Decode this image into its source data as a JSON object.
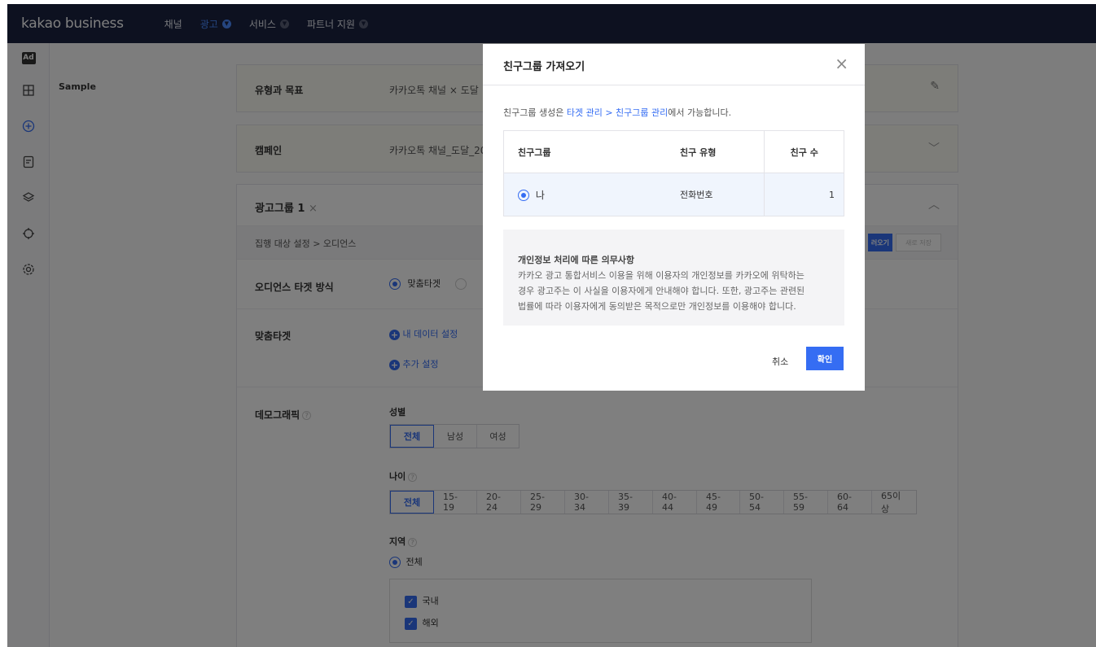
{
  "topbar": {
    "brand": "kakao business",
    "nav": [
      {
        "label": "채널",
        "dropdown": false,
        "active": false
      },
      {
        "label": "광고",
        "dropdown": true,
        "active": true
      },
      {
        "label": "서비스",
        "dropdown": true,
        "active": false
      },
      {
        "label": "파트너 지원",
        "dropdown": true,
        "active": false
      }
    ]
  },
  "rail": {
    "ad_badge": "Ad",
    "items": [
      "dashboard-icon",
      "add-circle-icon",
      "document-icon",
      "layers-icon",
      "target-icon",
      "settings-icon"
    ]
  },
  "main": {
    "sample_label": "Sample",
    "type_goal": {
      "label": "유형과 목표",
      "value": "카카오톡 채널 × 도달"
    },
    "campaign": {
      "label": "캠페인",
      "value": "카카오톡 채널_도달_20"
    },
    "adgroup": {
      "title": "광고그룹 1",
      "breadcrumb": "집행 대상 설정 > 오디언스",
      "load_button": "러오기",
      "save_button": "새로 저장",
      "audience_method": {
        "label": "오디언스 타겟 방식",
        "option_selected": "맞춤타겟"
      },
      "custom_target": {
        "label": "맞춤타겟",
        "my_data": "내 데이터 설정",
        "extra": "추가 설정"
      },
      "demographic": {
        "label": "데모그래픽",
        "gender": {
          "label": "성별",
          "options": [
            "전체",
            "남성",
            "여성"
          ],
          "selected": "전체"
        },
        "age": {
          "label": "나이",
          "options": [
            "전체",
            "15-19",
            "20-24",
            "25-29",
            "30-34",
            "35-39",
            "40-44",
            "45-49",
            "50-54",
            "55-59",
            "60-64",
            "65이상"
          ],
          "selected": "전체"
        },
        "region": {
          "label": "지역",
          "radio_all": "전체",
          "checks": [
            "국내",
            "해외"
          ]
        }
      }
    }
  },
  "modal": {
    "title": "친구그룹 가져오기",
    "info_prefix": "친구그룹 생성은 ",
    "info_link": "타겟 관리 > 친구그룹 관리",
    "info_suffix": "에서 가능합니다.",
    "table": {
      "headers": [
        "친구그룹",
        "친구 유형",
        "친구 수"
      ],
      "rows": [
        {
          "name": "나",
          "type": "전화번호",
          "count": "1"
        }
      ]
    },
    "notice_title": "개인정보 처리에 따른 의무사항",
    "notice_lines": [
      "카카오 광고 통합서비스 이용을 위해 이용자의 개인정보를 카카오에 위탁하는",
      "경우 광고주는 이 사실을 이용자에게 안내해야 합니다. 또한, 광고주는 관련된",
      "법률에 따라 이용자에게 동의받은 목적으로만 개인정보를 이용해야 합니다."
    ],
    "cancel": "취소",
    "confirm": "확인"
  },
  "colors": {
    "navy": "#1a2341",
    "accent": "#356df3"
  }
}
